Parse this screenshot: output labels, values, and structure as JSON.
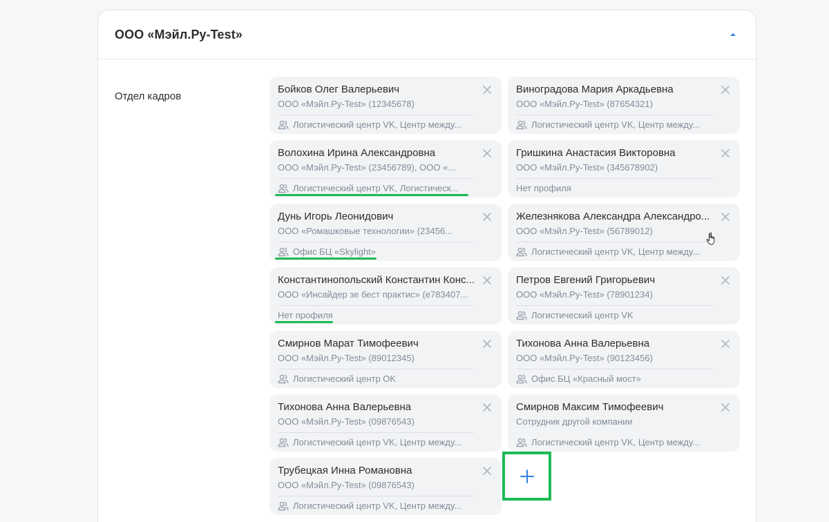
{
  "panel": {
    "title": "ООО «Мэйл.Ру-Test»",
    "collapse_icon": "chevron-up-icon"
  },
  "section": {
    "label": "Отдел кадров"
  },
  "cards": [
    {
      "name": "Бойков Олег Валерьевич",
      "org": "ООО «Мэйл.Ру-Test» (12345678)",
      "profile": "Логистический центр VK, Центр между...",
      "has_icon": true
    },
    {
      "name": "Виноградова Мария Аркадьевна",
      "org": "ООО «Мэйл.Ру-Test» (87654321)",
      "profile": "Логистический центр VK, Центр между...",
      "has_icon": true
    },
    {
      "name": "Волохина Ирина Александровна",
      "org": "ООО «Мэйл.Ру-Test» (23456789), ООО «...",
      "profile": "Логистический центр VK, Логистическ...",
      "has_icon": true
    },
    {
      "name": "Гришкина Анастасия Викторовна",
      "org": "ООО «Мэйл.Ру-Test» (345678902)",
      "profile": "Нет профиля",
      "has_icon": false
    },
    {
      "name": "Дунь Игорь Леонидович",
      "org": "ООО «Ромашковые технологии» (23456...",
      "profile": "Офис БЦ «Skylight»",
      "has_icon": true
    },
    {
      "name": "Железнякова Александра Александро...",
      "org": "ООО «Мэйл.Ру-Test» (56789012)",
      "profile": "Логистический центр VK, Центр между...",
      "has_icon": true
    },
    {
      "name": "Константинопольский Константин Конс...",
      "org": "ООО «Инсайдер зе бест практис» (е783407...",
      "profile": "Нет профиля",
      "has_icon": false
    },
    {
      "name": "Петров Евгений Григорьевич",
      "org": "ООО «Мэйл.Ру-Test» (78901234)",
      "profile": "Логистический центр VK",
      "has_icon": true
    },
    {
      "name": "Смирнов Марат Тимофеевич",
      "org": "ООО «Мэйл.Ру-Test» (89012345)",
      "profile": "Логистический центр OK",
      "has_icon": true
    },
    {
      "name": "Тихонова Анна Валерьевна",
      "org": "ООО «Мэйл.Ру-Test» (90123456)",
      "profile": "Офис БЦ «Красный мост»",
      "has_icon": true
    },
    {
      "name": "Тихонова Анна Валерьевна",
      "org": "ООО «Мэйл.Ру-Test» (09876543)",
      "profile": "Логистический центр VK, Центр между...",
      "has_icon": true
    },
    {
      "name": "Смирнов Максим Тимофеевич",
      "org": "Сотрудник другой компании",
      "profile": "Логистический центр VK, Центр между...",
      "has_icon": true,
      "no_divider": true
    },
    {
      "name": "Трубецкая Инна Романовна",
      "org": "ООО «Мэйл.Ру-Test» (09876543)",
      "profile": "Логистический центр VK, Центр между...",
      "has_icon": true
    }
  ],
  "colors": {
    "accent": "#2d81e0",
    "highlight": "#1db954",
    "card_bg": "#f2f3f5",
    "secondary_text": "#818c99"
  }
}
